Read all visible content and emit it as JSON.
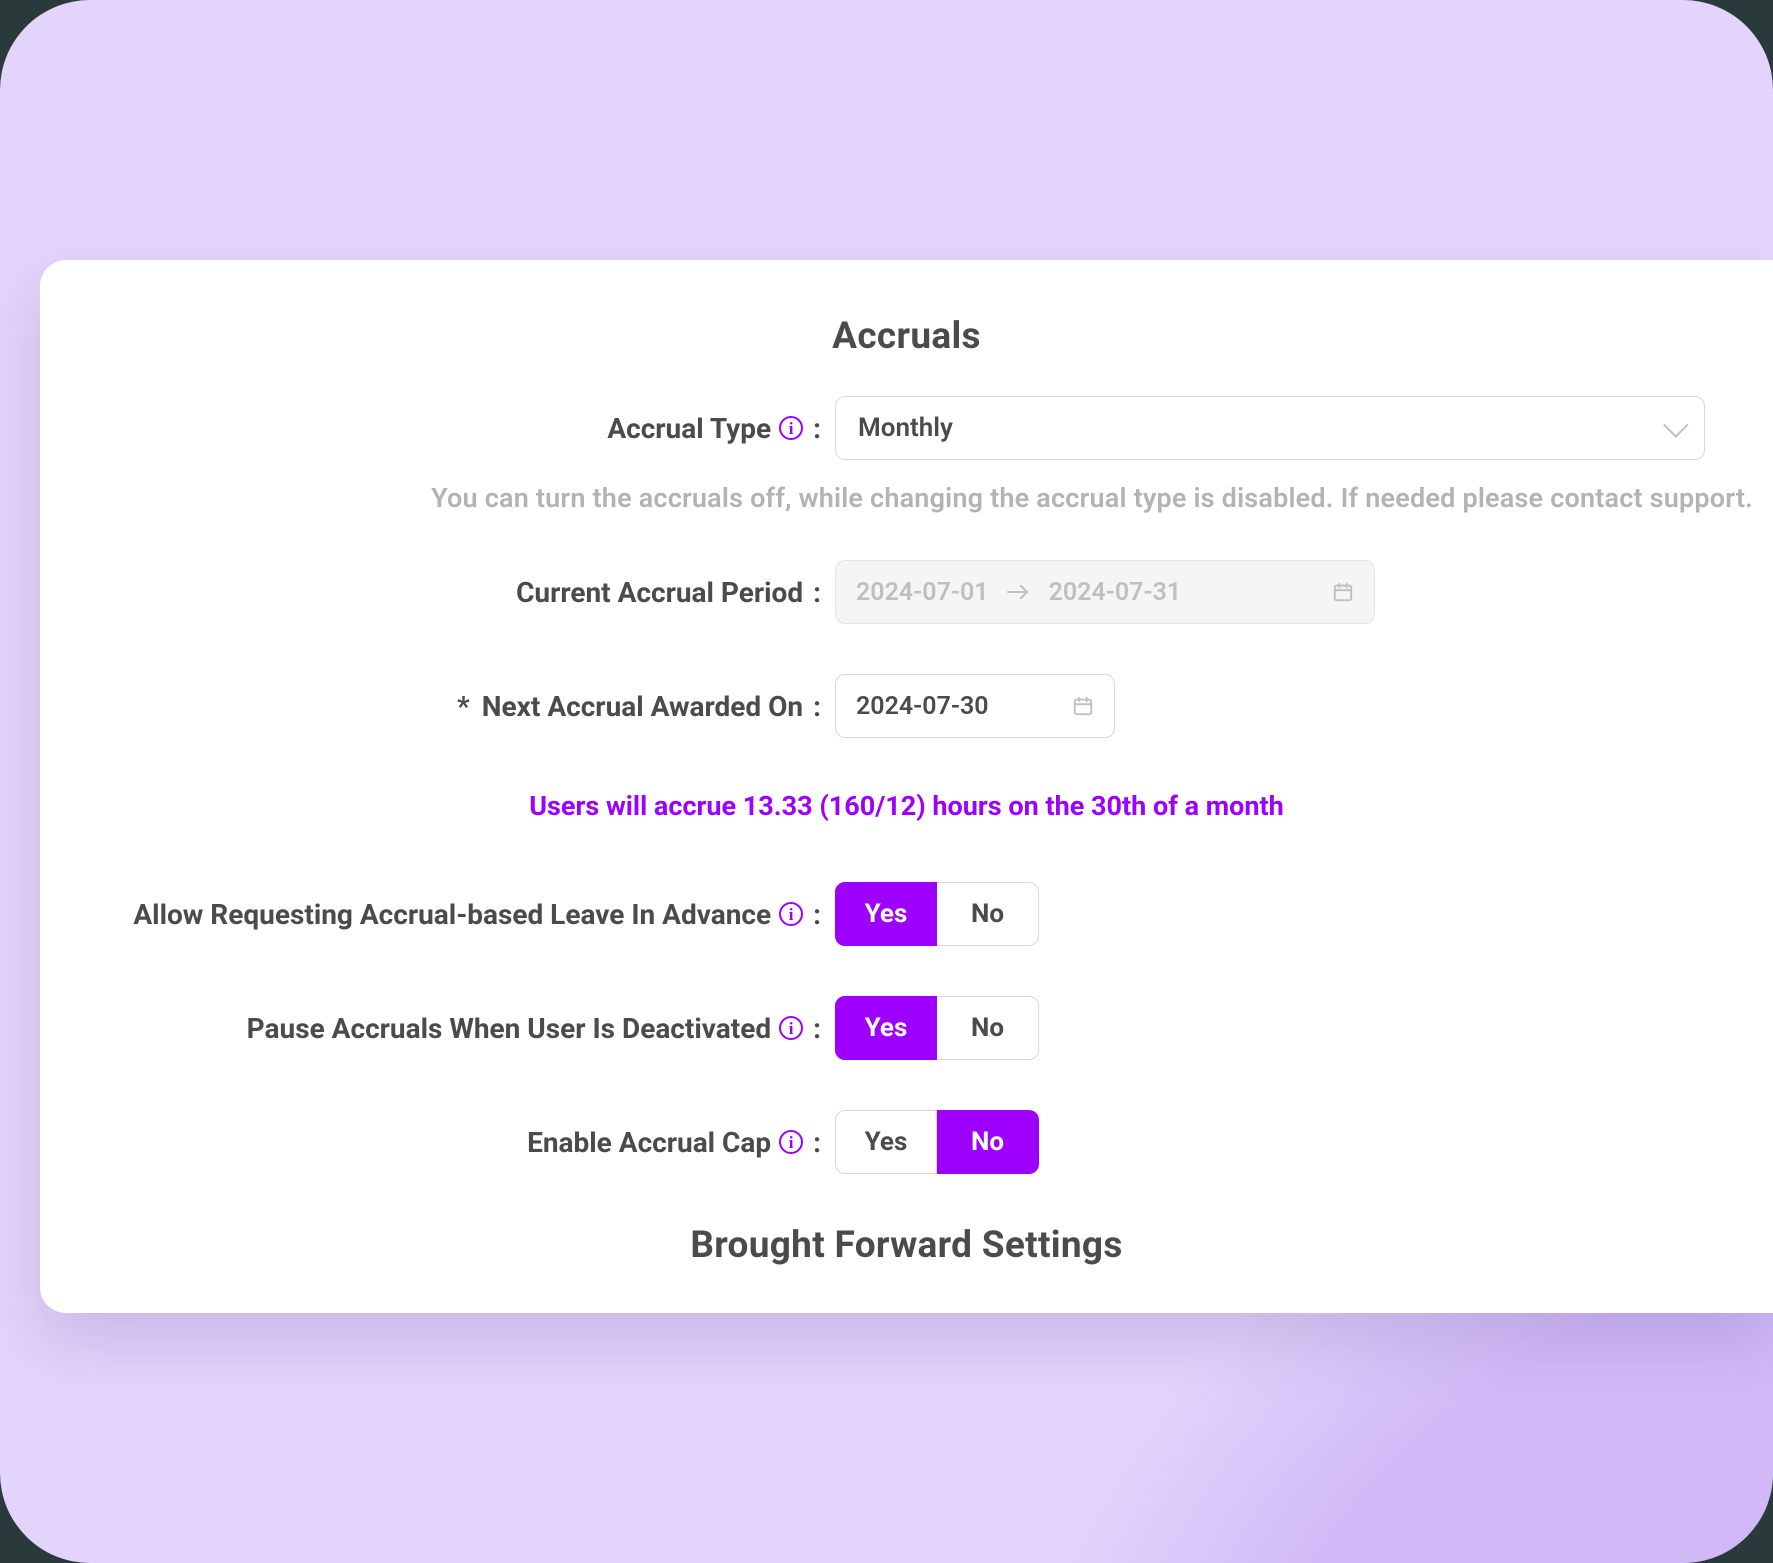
{
  "sections": {
    "accruals_title": "Accruals",
    "brought_forward_title": "Brought Forward Settings"
  },
  "accrual_type": {
    "label": "Accrual Type",
    "value": "Monthly",
    "help": "You can turn the accruals off, while changing the accrual type is disabled. If needed please contact support."
  },
  "current_period": {
    "label": "Current Accrual Period",
    "start": "2024-07-01",
    "end": "2024-07-31"
  },
  "next_awarded": {
    "label": "Next Accrual Awarded On",
    "value": "2024-07-30"
  },
  "accrue_note": "Users will accrue 13.33 (160/12) hours on the 30th of a month",
  "allow_advance": {
    "label": "Allow Requesting Accrual-based Leave In Advance",
    "yes": "Yes",
    "no": "No",
    "value": "Yes"
  },
  "pause_deactivated": {
    "label": "Pause Accruals When User Is Deactivated",
    "yes": "Yes",
    "no": "No",
    "value": "Yes"
  },
  "accrual_cap": {
    "label": "Enable Accrual Cap",
    "yes": "Yes",
    "no": "No",
    "value": "No"
  }
}
